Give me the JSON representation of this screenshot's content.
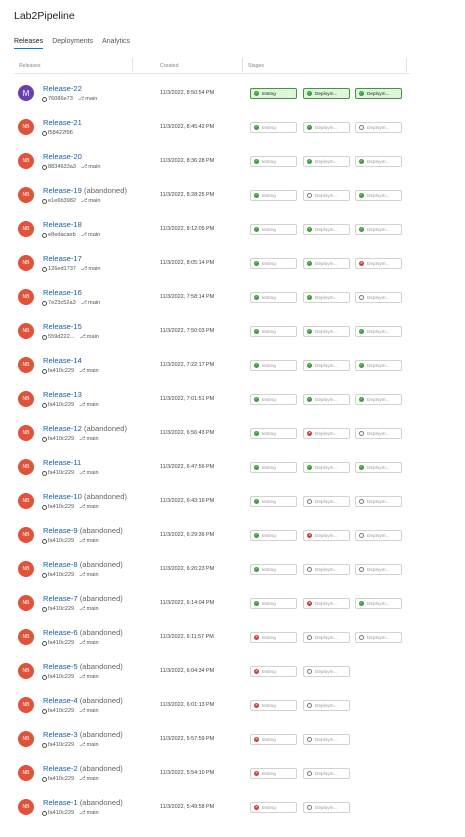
{
  "app": {
    "title": "Lab2Pipeline"
  },
  "tabs": [
    {
      "label": "Releases",
      "active": true
    },
    {
      "label": "Deployments",
      "active": false
    },
    {
      "label": "Analytics",
      "active": false
    }
  ],
  "columns": {
    "releases": "Releases",
    "created": "Created",
    "stages": "Stages"
  },
  "colors": {
    "accent": "#0078d4",
    "success": "#3a9b3a",
    "failure": "#cd3b3b",
    "avatar": "#e0523a",
    "avatar_m": "#6b3fb2"
  },
  "releases": [
    {
      "name": "Release-22",
      "abandoned": "",
      "commit": "76086e73",
      "branch": "main",
      "created": "11/3/2022, 8:50:54 PM",
      "avatar": "M",
      "stages": [
        {
          "label": "testing",
          "status": "succeeded",
          "highlight": true
        },
        {
          "label": "Deploym...",
          "status": "succeeded",
          "highlight": true
        },
        {
          "label": "Deploym...",
          "status": "succeeded",
          "highlight": true
        }
      ]
    },
    {
      "name": "Release-21",
      "abandoned": "",
      "commit": "f58422f96",
      "branch": "",
      "created": "11/3/2022, 8:45:42 PM",
      "avatar": "NB",
      "stages": [
        {
          "label": "testing",
          "status": "succeeded"
        },
        {
          "label": "Deploym...",
          "status": "succeeded"
        },
        {
          "label": "Deploym...",
          "status": "notstarted"
        }
      ]
    },
    {
      "name": "Release-20",
      "abandoned": "",
      "commit": "8834633a3",
      "branch": "main",
      "created": "11/3/2022, 8:36:28 PM",
      "avatar": "NB",
      "stages": [
        {
          "label": "testing",
          "status": "succeeded"
        },
        {
          "label": "Deploym...",
          "status": "succeeded"
        },
        {
          "label": "Deploym...",
          "status": "succeeded"
        }
      ]
    },
    {
      "name": "Release-19",
      "abandoned": "(abandoned)",
      "commit": "e1e6b3982",
      "branch": "main",
      "created": "11/3/2022, 8:28:25 PM",
      "avatar": "NB",
      "stages": [
        {
          "label": "testing",
          "status": "succeeded"
        },
        {
          "label": "Deploym...",
          "status": "notstarted"
        },
        {
          "label": "Deploym...",
          "status": "succeeded"
        }
      ]
    },
    {
      "name": "Release-18",
      "abandoned": "",
      "commit": "e8edacaeb",
      "branch": "main",
      "created": "11/3/2022, 8:12:05 PM",
      "avatar": "NB",
      "stages": [
        {
          "label": "testing",
          "status": "succeeded"
        },
        {
          "label": "Deploym...",
          "status": "succeeded"
        },
        {
          "label": "Deploym...",
          "status": "succeeded"
        }
      ]
    },
    {
      "name": "Release-17",
      "abandoned": "",
      "commit": "126ed1737",
      "branch": "main",
      "created": "11/3/2022, 8:05:14 PM",
      "avatar": "NB",
      "stages": [
        {
          "label": "testing",
          "status": "succeeded"
        },
        {
          "label": "Deploym...",
          "status": "succeeded"
        },
        {
          "label": "Deploym...",
          "status": "failed"
        }
      ]
    },
    {
      "name": "Release-16",
      "abandoned": "",
      "commit": "7e23c52a3",
      "branch": "main",
      "created": "11/3/2022, 7:58:14 PM",
      "avatar": "NB",
      "stages": [
        {
          "label": "testing",
          "status": "succeeded"
        },
        {
          "label": "Deploym...",
          "status": "succeeded"
        },
        {
          "label": "Deploym...",
          "status": "notstarted"
        }
      ]
    },
    {
      "name": "Release-15",
      "abandoned": "",
      "commit": "559d222...",
      "branch": "main",
      "created": "11/3/2022, 7:50:03 PM",
      "avatar": "NB",
      "stages": [
        {
          "label": "testing",
          "status": "succeeded"
        },
        {
          "label": "Deploym...",
          "status": "succeeded"
        },
        {
          "label": "Deploym...",
          "status": "succeeded"
        }
      ]
    },
    {
      "name": "Release-14",
      "abandoned": "",
      "commit": "fa410c229",
      "branch": "main",
      "created": "11/3/2022, 7:22:17 PM",
      "avatar": "NB",
      "stages": [
        {
          "label": "testing",
          "status": "succeeded"
        },
        {
          "label": "Deploym...",
          "status": "succeeded"
        },
        {
          "label": "Deploym...",
          "status": "succeeded"
        }
      ]
    },
    {
      "name": "Release-13",
      "abandoned": "",
      "commit": "fa410c229",
      "branch": "main",
      "created": "11/3/2022, 7:01:51 PM",
      "avatar": "NB",
      "stages": [
        {
          "label": "testing",
          "status": "succeeded"
        },
        {
          "label": "Deploym...",
          "status": "succeeded"
        },
        {
          "label": "Deploym...",
          "status": "succeeded"
        }
      ]
    },
    {
      "name": "Release-12",
      "abandoned": "(abandoned)",
      "commit": "fa410c229",
      "branch": "main",
      "created": "11/3/2022, 6:56:43 PM",
      "avatar": "NB",
      "stages": [
        {
          "label": "testing",
          "status": "succeeded"
        },
        {
          "label": "Deploym...",
          "status": "failed"
        },
        {
          "label": "Deploym...",
          "status": "notstarted"
        }
      ]
    },
    {
      "name": "Release-11",
      "abandoned": "",
      "commit": "fa410c229",
      "branch": "main",
      "created": "11/3/2022, 6:47:56 PM",
      "avatar": "NB",
      "stages": [
        {
          "label": "testing",
          "status": "succeeded"
        },
        {
          "label": "Deploym...",
          "status": "succeeded"
        },
        {
          "label": "Deploym...",
          "status": "succeeded"
        }
      ]
    },
    {
      "name": "Release-10",
      "abandoned": "(abandoned)",
      "commit": "fa410c229",
      "branch": "main",
      "created": "11/3/2022, 6:43:16 PM",
      "avatar": "NB",
      "stages": [
        {
          "label": "testing",
          "status": "succeeded"
        },
        {
          "label": "Deploym...",
          "status": "notstarted"
        },
        {
          "label": "Deploym...",
          "status": "notstarted"
        }
      ]
    },
    {
      "name": "Release-9",
      "abandoned": "(abandoned)",
      "commit": "fa410c229",
      "branch": "main",
      "created": "11/3/2022, 6:29:36 PM",
      "avatar": "NB",
      "stages": [
        {
          "label": "testing",
          "status": "succeeded"
        },
        {
          "label": "Deploym...",
          "status": "failed"
        },
        {
          "label": "Deploym...",
          "status": "notstarted"
        }
      ]
    },
    {
      "name": "Release-8",
      "abandoned": "(abandoned)",
      "commit": "fa410c229",
      "branch": "main",
      "created": "11/3/2022, 6:20:23 PM",
      "avatar": "NB",
      "stages": [
        {
          "label": "testing",
          "status": "succeeded"
        },
        {
          "label": "Deploym...",
          "status": "notstarted"
        },
        {
          "label": "Deploym...",
          "status": "notstarted"
        }
      ]
    },
    {
      "name": "Release-7",
      "abandoned": "(abandoned)",
      "commit": "fa410c229",
      "branch": "main",
      "created": "11/3/2022, 6:14:04 PM",
      "avatar": "NB",
      "stages": [
        {
          "label": "testing",
          "status": "succeeded"
        },
        {
          "label": "Deploym...",
          "status": "failed"
        },
        {
          "label": "Deploym...",
          "status": "succeeded"
        }
      ]
    },
    {
      "name": "Release-6",
      "abandoned": "(abandoned)",
      "commit": "fa410c229",
      "branch": "main",
      "created": "11/3/2022, 6:11:57 PM",
      "avatar": "NB",
      "stages": [
        {
          "label": "testing",
          "status": "failed"
        },
        {
          "label": "Deploym...",
          "status": "notstarted"
        },
        {
          "label": "Deploym...",
          "status": "notstarted"
        }
      ]
    },
    {
      "name": "Release-5",
      "abandoned": "(abandoned)",
      "commit": "fa410c229",
      "branch": "main",
      "created": "11/3/2022, 6:04:34 PM",
      "avatar": "NB",
      "stages": [
        {
          "label": "testing",
          "status": "failed"
        },
        {
          "label": "Deploym...",
          "status": "notstarted"
        }
      ]
    },
    {
      "name": "Release-4",
      "abandoned": "(abandoned)",
      "commit": "fa410c229",
      "branch": "main",
      "created": "11/3/2022, 6:01:13 PM",
      "avatar": "NB",
      "stages": [
        {
          "label": "testing",
          "status": "failed"
        },
        {
          "label": "Deploym...",
          "status": "notstarted"
        }
      ]
    },
    {
      "name": "Release-3",
      "abandoned": "(abandoned)",
      "commit": "fa410c229",
      "branch": "main",
      "created": "11/3/2022, 5:57:59 PM",
      "avatar": "NB",
      "stages": [
        {
          "label": "testing",
          "status": "failed"
        },
        {
          "label": "Deploym...",
          "status": "notstarted"
        }
      ]
    },
    {
      "name": "Release-2",
      "abandoned": "(abandoned)",
      "commit": "fa410c229",
      "branch": "main",
      "created": "11/3/2022, 5:54:10 PM",
      "avatar": "NB",
      "stages": [
        {
          "label": "testing",
          "status": "failed"
        },
        {
          "label": "Deploym...",
          "status": "notstarted"
        }
      ]
    },
    {
      "name": "Release-1",
      "abandoned": "(abandoned)",
      "commit": "fa410c229",
      "branch": "main",
      "created": "11/3/2022, 5:49:58 PM",
      "avatar": "NB",
      "stages": [
        {
          "label": "testing",
          "status": "failed"
        },
        {
          "label": "Deploym...",
          "status": "notstarted"
        }
      ]
    }
  ]
}
